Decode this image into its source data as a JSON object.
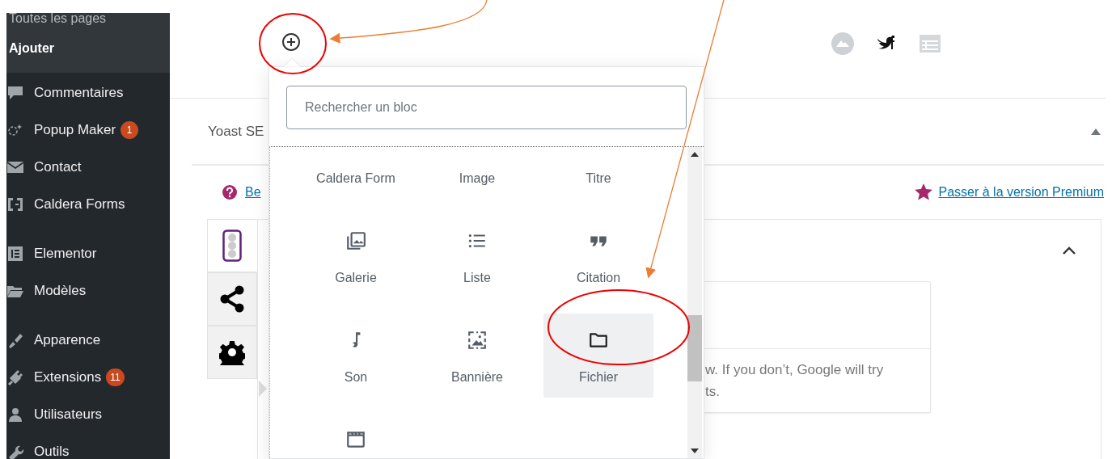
{
  "sidebar": {
    "submenu": [
      {
        "label": "Toutes les pages",
        "selected": false
      },
      {
        "label": "Ajouter",
        "selected": true
      }
    ],
    "groups": [
      [
        {
          "label": "Commentaires"
        },
        {
          "label": "Popup Maker",
          "badge": "1"
        },
        {
          "label": "Contact"
        },
        {
          "label": "Caldera Forms"
        }
      ],
      [
        {
          "label": "Elementor"
        },
        {
          "label": "Modèles"
        }
      ],
      [
        {
          "label": "Apparence"
        },
        {
          "label": "Extensions",
          "badge": "11"
        },
        {
          "label": "Utilisateurs"
        },
        {
          "label": "Outils"
        }
      ]
    ]
  },
  "yoast": {
    "title": "Yoast SE",
    "expanded": true,
    "help_link": "Be",
    "premium_link": "Passer à la version Premium",
    "side_tabs": [
      {
        "selected": true
      },
      {
        "selected": false
      },
      {
        "selected": false
      }
    ],
    "card_text": [
      "w. If you don’t, Google will try",
      "ts."
    ]
  },
  "inserter": {
    "search": {
      "placeholder": "Rechercher un bloc"
    },
    "blocks": [
      {
        "label": "Caldera Form",
        "highlighted": false
      },
      {
        "label": "Image",
        "highlighted": false
      },
      {
        "label": "Titre",
        "highlighted": false
      },
      {
        "label": "Galerie",
        "highlighted": false
      },
      {
        "label": "Liste",
        "highlighted": false
      },
      {
        "label": "Citation",
        "highlighted": false
      },
      {
        "label": "Son",
        "highlighted": false
      },
      {
        "label": "Bannière",
        "highlighted": false
      },
      {
        "label": "Fichier",
        "highlighted": true
      },
      {
        "highlighted": false
      }
    ]
  }
}
